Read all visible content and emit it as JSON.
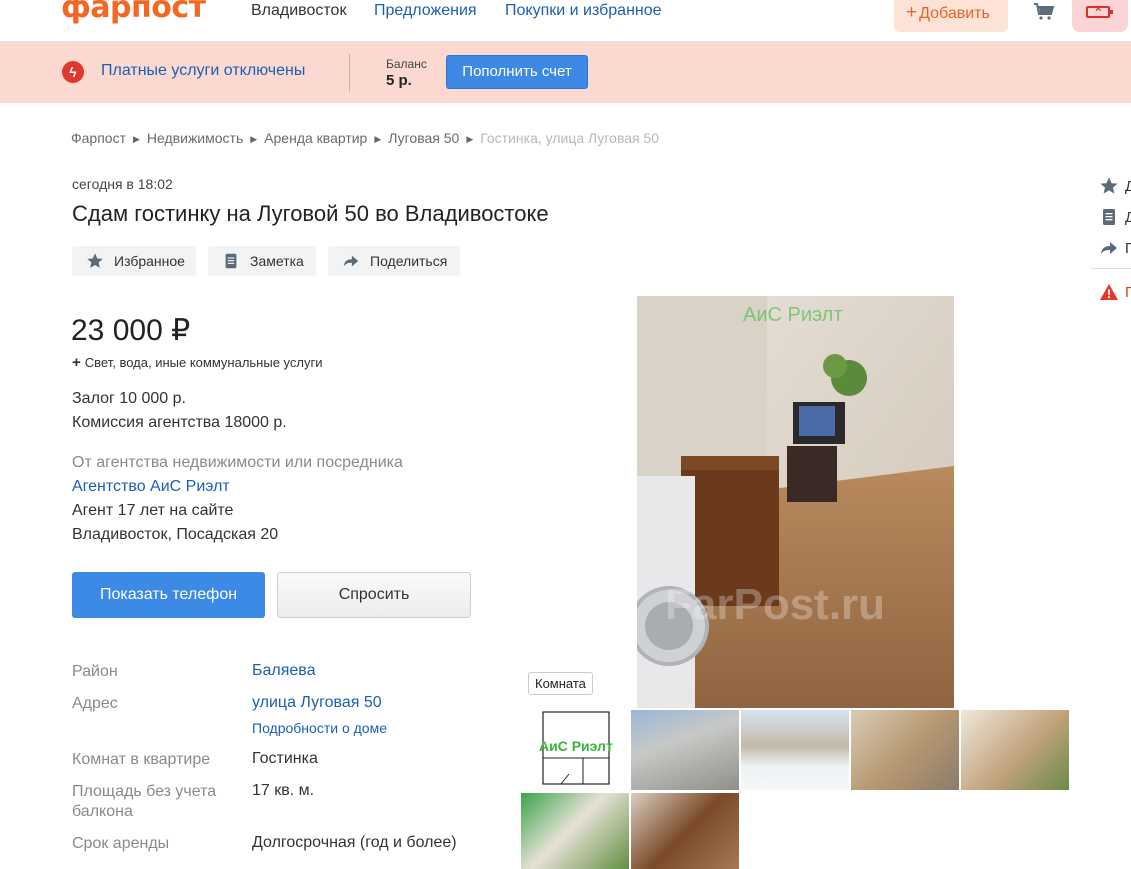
{
  "header": {
    "logo": "фарпост",
    "city": "Владивосток",
    "nav": [
      "Предложения",
      "Покупки и избранное"
    ],
    "add_label": "Добавить",
    "add_plus": "+",
    "cart_icon": "cart-icon",
    "battery_icon": "battery-icon"
  },
  "banner": {
    "status": "Платные услуги отключены",
    "balance_label": "Баланс",
    "balance_value": "5 р.",
    "topup_label": "Пополнить счет"
  },
  "breadcrumbs": [
    "Фарпост",
    "Недвижимость",
    "Аренда квартир",
    "Луговая 50",
    "Гостинка, улица Луговая 50"
  ],
  "listing": {
    "date": "сегодня в 18:02",
    "title": "Сдам гостинку на Луговой 50 во Владивостоке",
    "actions": [
      "Избранное",
      "Заметка",
      "Поделиться"
    ],
    "price": "23 000 ₽",
    "utilities_plus": "+",
    "utilities": "Свет, вода, иные коммунальные услуги",
    "deposit": "Залог 10 000 р.",
    "commission": "Комиссия агентства 18000 р.",
    "source": "От агентства недвижимости или посредника",
    "agency": "Агентство АиС Риэлт",
    "agent_age": "Агент 17 лет на сайте",
    "agency_address": "Владивосток, Посадская 20",
    "show_phone": "Показать телефон",
    "ask": "Спросить"
  },
  "properties": [
    {
      "label": "Район",
      "value": "Баляева"
    },
    {
      "label": "Адрес",
      "value": "улица Луговая 50",
      "sub": "Подробности о доме"
    },
    {
      "label": "Комнат в квартире",
      "value": "Гостинка"
    },
    {
      "label": "Площадь без учета балкона",
      "value": "17 кв. м."
    },
    {
      "label": "Срок аренды",
      "value": "Долгосрочная (год и более)"
    }
  ],
  "gallery": {
    "watermark_agency": "АиС Риэлт",
    "watermark_site": "FarPost.ru",
    "room_tag": "Комната",
    "plan_label": "АиС Риэлт"
  },
  "rail": {
    "items": [
      "Д",
      "Д",
      "П",
      "П"
    ],
    "icons": [
      "star-icon",
      "note-icon",
      "share-icon",
      "warning-icon"
    ]
  },
  "colors": {
    "brand": "#f26722",
    "link": "#1a5fb4",
    "primary_button": "#3d8ae6",
    "banner_bg": "#fbd9d0",
    "alert": "#e2372d"
  }
}
